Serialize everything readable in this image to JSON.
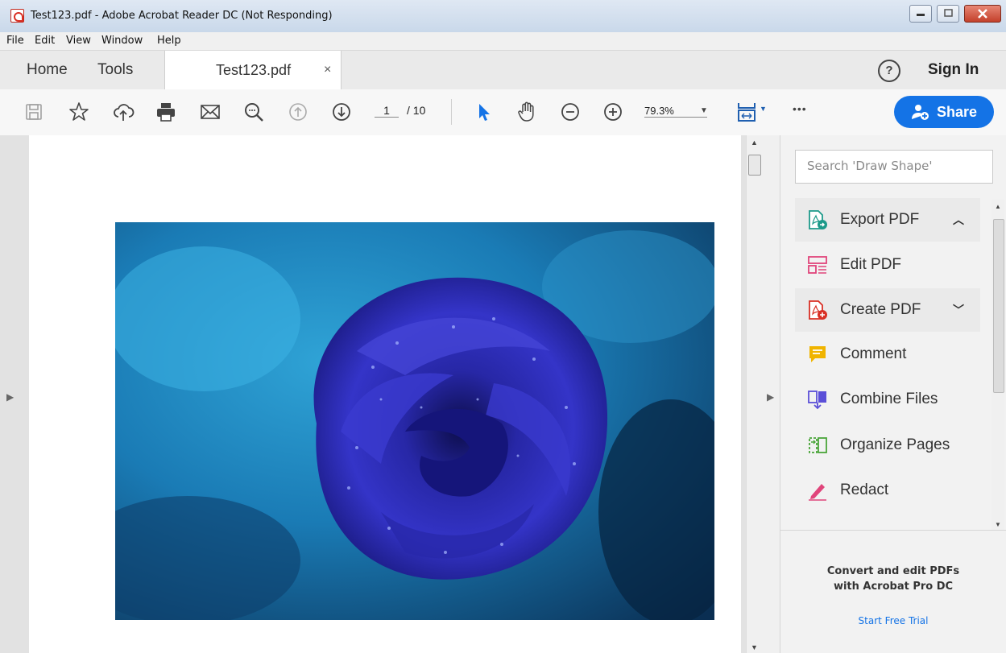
{
  "window": {
    "title": "Test123.pdf - Adobe Acrobat Reader DC (Not Responding)"
  },
  "menu": [
    "File",
    "Edit",
    "View",
    "Window",
    "Help"
  ],
  "tabs": {
    "home": "Home",
    "tools": "Tools",
    "document": "Test123.pdf",
    "close": "×"
  },
  "header": {
    "help_icon": "?",
    "sign_in": "Sign In"
  },
  "toolbar": {
    "icons": [
      "save-icon",
      "star-icon",
      "upload-cloud-icon",
      "print-icon",
      "email-icon",
      "find-icon",
      "page-up-icon",
      "page-down-icon",
      "select-arrow-icon",
      "hand-icon",
      "zoom-out-icon",
      "zoom-in-icon",
      "fit-page-icon",
      "more-icon"
    ],
    "page_current": "1",
    "page_total": "/ 10",
    "zoom": "79.3%",
    "more": "•••",
    "share": "Share"
  },
  "document": {
    "image": "blue-rose-photo"
  },
  "right_pane": {
    "search_placeholder": "Search 'Draw Shape'",
    "tools": [
      {
        "label": "Export PDF",
        "icon": "export-pdf-icon",
        "color": "#1d9a8a"
      },
      {
        "label": "Edit PDF",
        "icon": "edit-pdf-icon",
        "color": "#e0457b"
      },
      {
        "label": "Create PDF",
        "icon": "create-pdf-icon",
        "color": "#d93025"
      },
      {
        "label": "Comment",
        "icon": "comment-icon",
        "color": "#f0b400"
      },
      {
        "label": "Combine Files",
        "icon": "combine-files-icon",
        "color": "#5b4fd8"
      },
      {
        "label": "Organize Pages",
        "icon": "organize-pages-icon",
        "color": "#4aa53a"
      },
      {
        "label": "Redact",
        "icon": "redact-icon",
        "color": "#e0457b"
      }
    ],
    "promo_line1": "Convert and edit PDFs",
    "promo_line2": "with Acrobat Pro DC",
    "trial": "Start Free Trial"
  },
  "colors": {
    "accent": "#1473e6",
    "toolbar_bg": "#f7f7f7",
    "tab_bg": "#eaeaea"
  }
}
